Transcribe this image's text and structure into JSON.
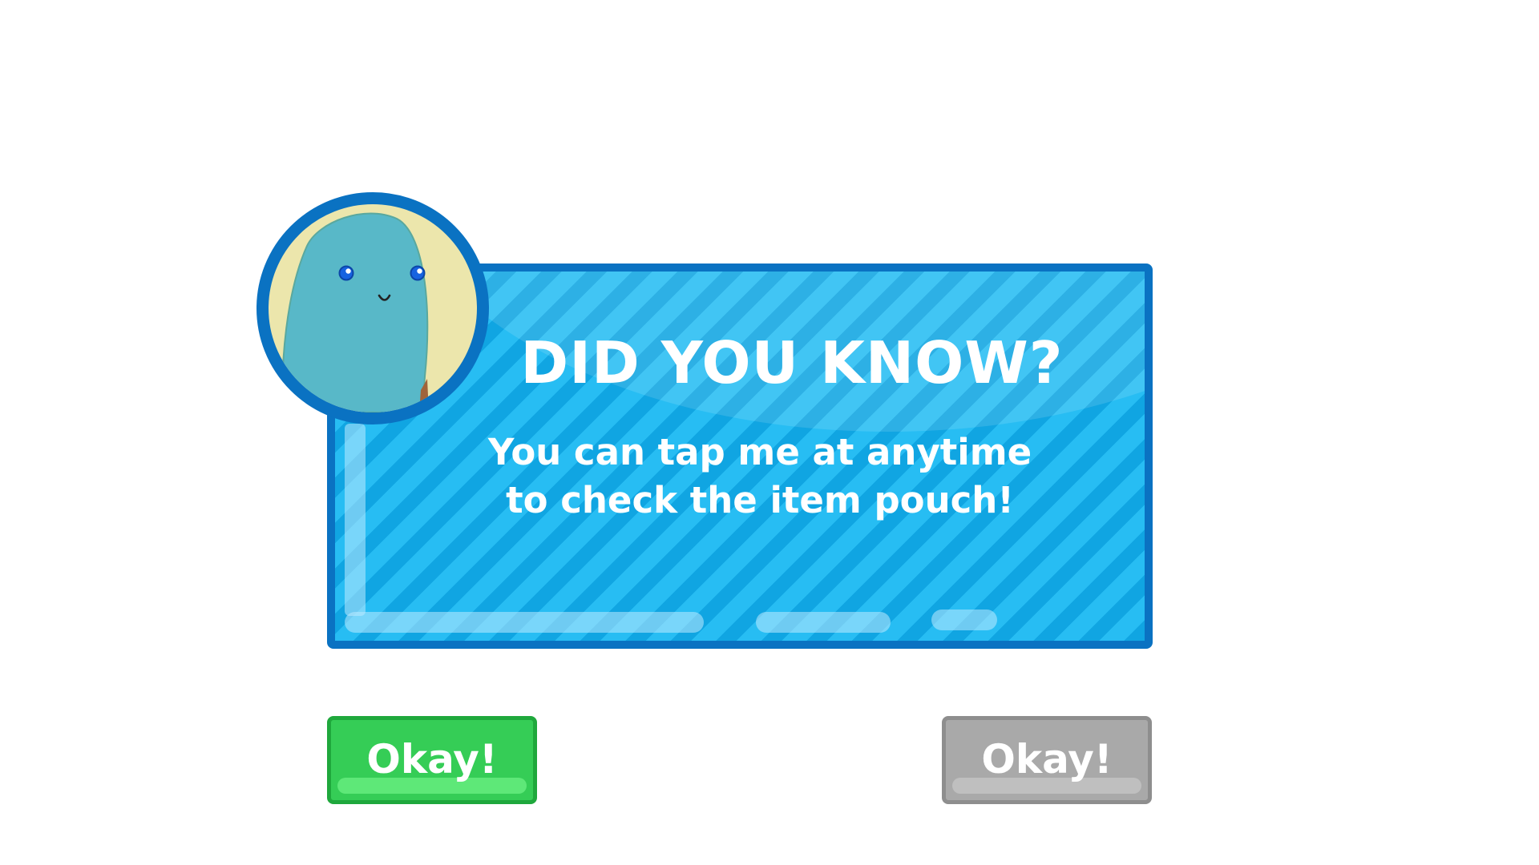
{
  "tip": {
    "title": "DID YOU KNOW?",
    "message_lines": [
      "You can tap me at anytime",
      "to check the item pouch!"
    ]
  },
  "avatar": {
    "icon": "blue-blob-character-icon"
  },
  "buttons": {
    "primary": {
      "label": "Okay!",
      "state": "enabled"
    },
    "secondary": {
      "label": "Okay!",
      "state": "disabled"
    }
  },
  "colors": {
    "panel_fill": "#1eb5ee",
    "panel_border": "#0a72c2",
    "button_enabled": "#35cd56",
    "button_disabled": "#a9a9a9",
    "avatar_background": "#ece6ac",
    "character_body": "#58b8c8"
  }
}
